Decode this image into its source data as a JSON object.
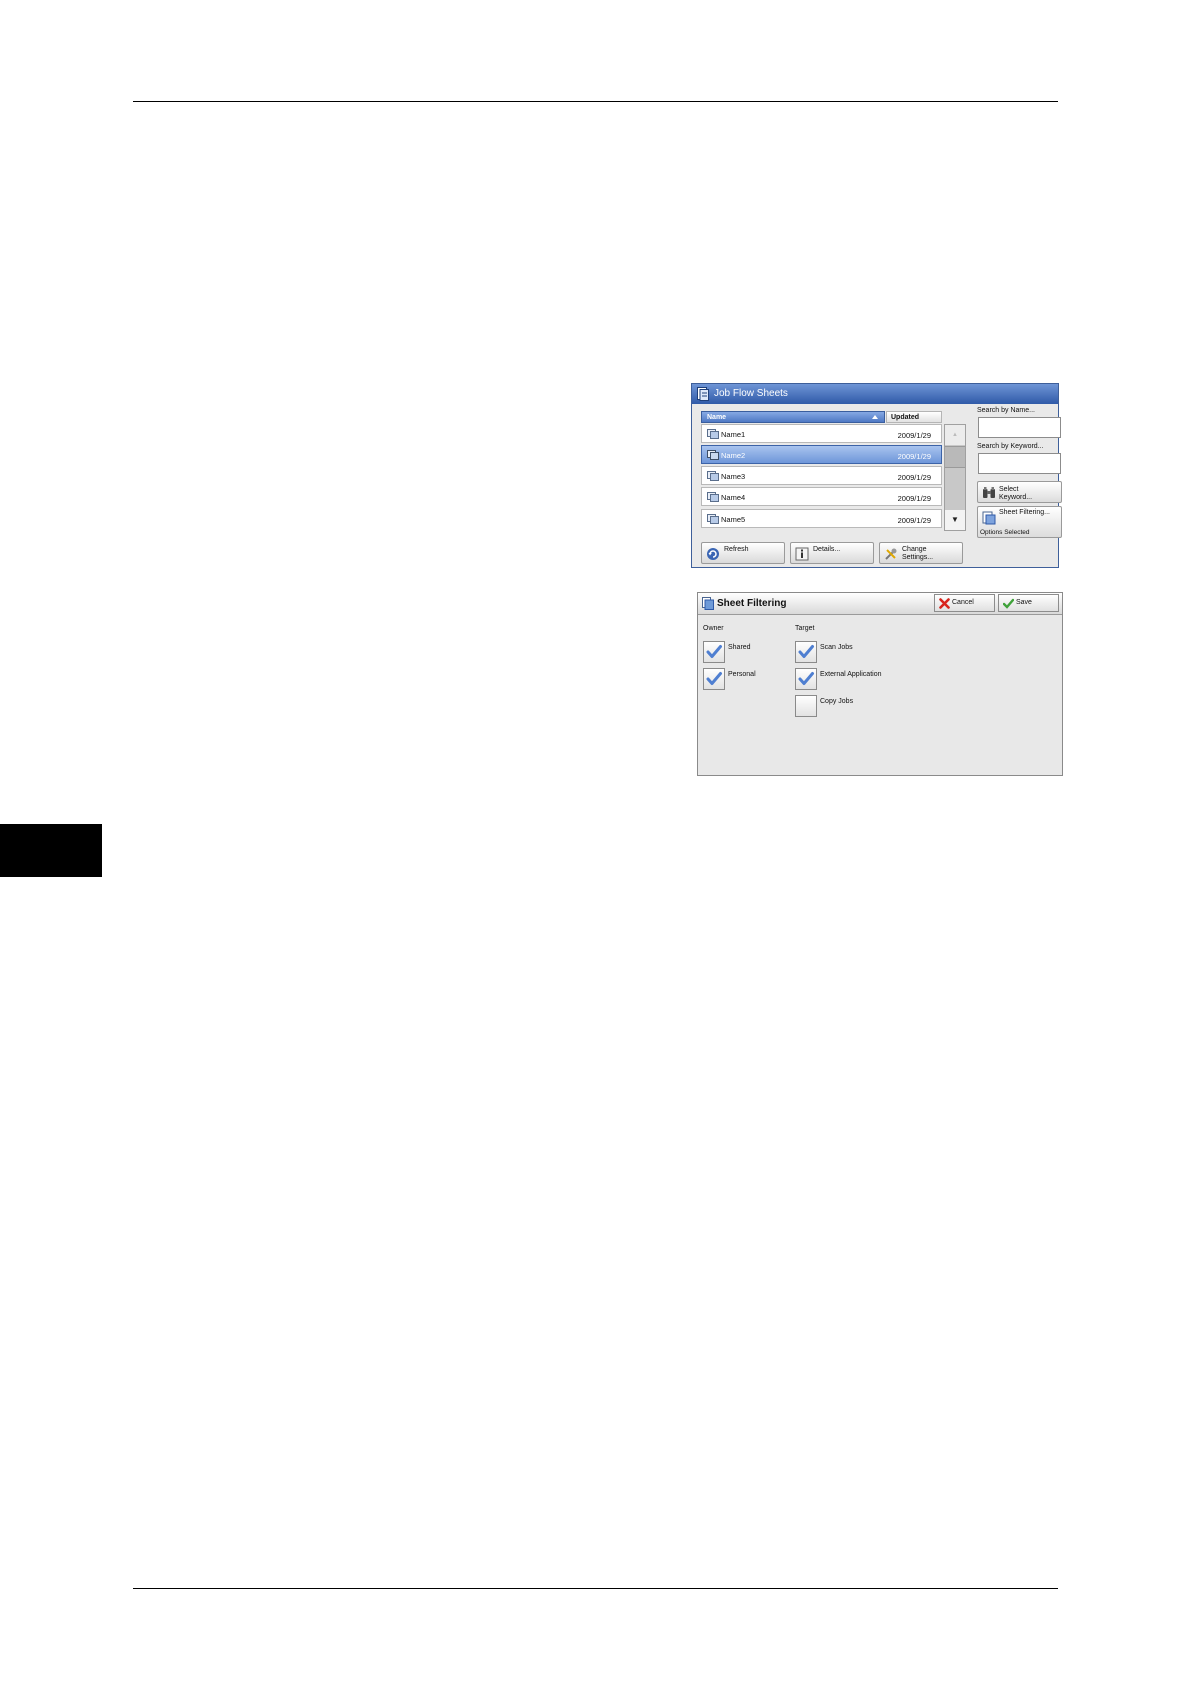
{
  "job_flow_sheets": {
    "title": "Job Flow Sheets",
    "columns": {
      "name": "Name",
      "updated": "Updated"
    },
    "rows": [
      {
        "name": "Name1",
        "date": "2009/1/29",
        "selected": false
      },
      {
        "name": "Name2",
        "date": "2009/1/29",
        "selected": true
      },
      {
        "name": "Name3",
        "date": "2009/1/29",
        "selected": false
      },
      {
        "name": "Name4",
        "date": "2009/1/29",
        "selected": false
      },
      {
        "name": "Name5",
        "date": "2009/1/29",
        "selected": false
      }
    ],
    "search_by_name_label": "Search by Name...",
    "search_by_keyword_label": "Search by Keyword...",
    "select_keyword_line1": "Select",
    "select_keyword_line2": "Keyword...",
    "sheet_filtering_label": "Sheet Filtering...",
    "options_selected": "Options Selected",
    "refresh_label": "Refresh",
    "details_label": "Details...",
    "change_settings_line1": "Change",
    "change_settings_line2": "Settings..."
  },
  "sheet_filtering": {
    "title": "Sheet Filtering",
    "cancel_label": "Cancel",
    "save_label": "Save",
    "owner": {
      "label": "Owner",
      "options": [
        {
          "label": "Shared",
          "checked": true
        },
        {
          "label": "Personal",
          "checked": true
        }
      ]
    },
    "target": {
      "label": "Target",
      "options": [
        {
          "label": "Scan Jobs",
          "checked": true
        },
        {
          "label": "External Application",
          "checked": true
        },
        {
          "label": "Copy Jobs",
          "checked": false
        }
      ]
    }
  },
  "colors": {
    "title_blue": "#2f5aa8",
    "selected_row": "#6e96d9",
    "check_blue": "#4f7fd1",
    "cancel_red": "#d8241d",
    "save_green": "#3fa23a"
  }
}
